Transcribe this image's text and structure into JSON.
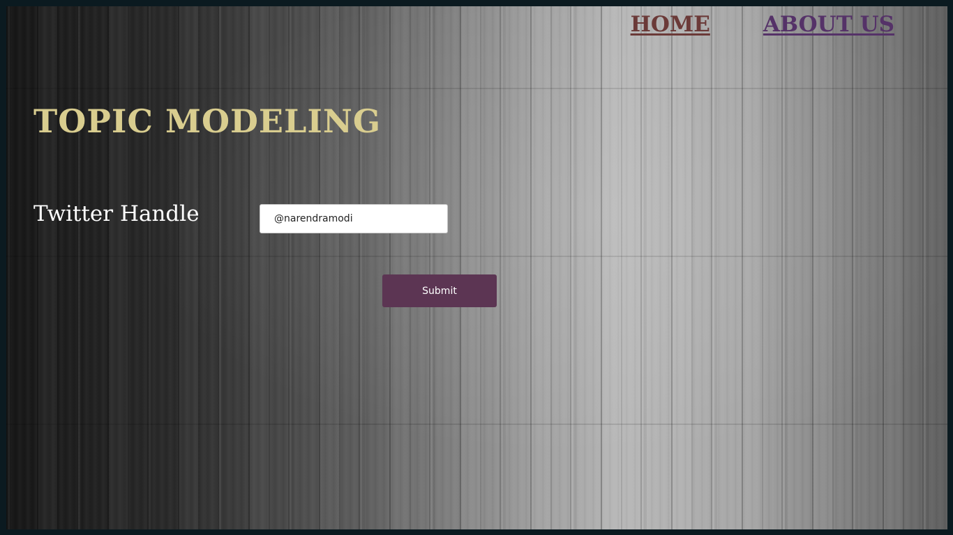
{
  "nav": {
    "home_label": "HOME",
    "about_label": "ABOUT US"
  },
  "header": {
    "title": "TOPIC MODELING"
  },
  "form": {
    "handle_label": "Twitter Handle",
    "handle_value": "@narendramodi",
    "submit_label": "Submit"
  },
  "colors": {
    "title": "#d9cd8f",
    "home_link": "#6b3a38",
    "about_link": "#553268",
    "submit_button": "#5c3553",
    "page_border": "#0b1a20"
  }
}
